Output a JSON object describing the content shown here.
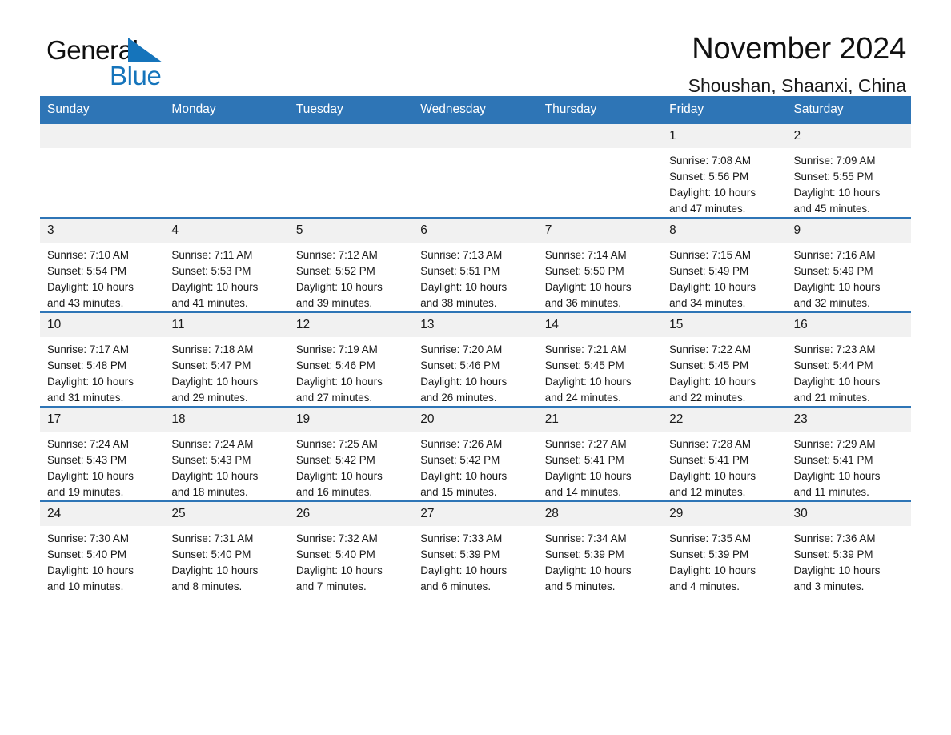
{
  "brand": {
    "word_one": "General",
    "word_two": "Blue",
    "accent_color": "#1574bb"
  },
  "header": {
    "title": "November 2024",
    "subtitle": "Shoushan, Shaanxi, China"
  },
  "theme": {
    "header_blue": "#2e75b6",
    "daynum_gray": "#f1f1f1",
    "text": "#1a1a1a"
  },
  "weekdays": [
    "Sunday",
    "Monday",
    "Tuesday",
    "Wednesday",
    "Thursday",
    "Friday",
    "Saturday"
  ],
  "labels": {
    "sunrise_prefix": "Sunrise:",
    "sunset_prefix": "Sunset:",
    "daylight_prefix": "Daylight:"
  },
  "weeks": [
    [
      {
        "day": "",
        "blank": true
      },
      {
        "day": "",
        "blank": true
      },
      {
        "day": "",
        "blank": true
      },
      {
        "day": "",
        "blank": true
      },
      {
        "day": "",
        "blank": true
      },
      {
        "day": "1",
        "sunrise": "Sunrise: 7:08 AM",
        "sunset": "Sunset: 5:56 PM",
        "daylight_1": "Daylight: 10 hours",
        "daylight_2": "and 47 minutes."
      },
      {
        "day": "2",
        "sunrise": "Sunrise: 7:09 AM",
        "sunset": "Sunset: 5:55 PM",
        "daylight_1": "Daylight: 10 hours",
        "daylight_2": "and 45 minutes."
      }
    ],
    [
      {
        "day": "3",
        "sunrise": "Sunrise: 7:10 AM",
        "sunset": "Sunset: 5:54 PM",
        "daylight_1": "Daylight: 10 hours",
        "daylight_2": "and 43 minutes."
      },
      {
        "day": "4",
        "sunrise": "Sunrise: 7:11 AM",
        "sunset": "Sunset: 5:53 PM",
        "daylight_1": "Daylight: 10 hours",
        "daylight_2": "and 41 minutes."
      },
      {
        "day": "5",
        "sunrise": "Sunrise: 7:12 AM",
        "sunset": "Sunset: 5:52 PM",
        "daylight_1": "Daylight: 10 hours",
        "daylight_2": "and 39 minutes."
      },
      {
        "day": "6",
        "sunrise": "Sunrise: 7:13 AM",
        "sunset": "Sunset: 5:51 PM",
        "daylight_1": "Daylight: 10 hours",
        "daylight_2": "and 38 minutes."
      },
      {
        "day": "7",
        "sunrise": "Sunrise: 7:14 AM",
        "sunset": "Sunset: 5:50 PM",
        "daylight_1": "Daylight: 10 hours",
        "daylight_2": "and 36 minutes."
      },
      {
        "day": "8",
        "sunrise": "Sunrise: 7:15 AM",
        "sunset": "Sunset: 5:49 PM",
        "daylight_1": "Daylight: 10 hours",
        "daylight_2": "and 34 minutes."
      },
      {
        "day": "9",
        "sunrise": "Sunrise: 7:16 AM",
        "sunset": "Sunset: 5:49 PM",
        "daylight_1": "Daylight: 10 hours",
        "daylight_2": "and 32 minutes."
      }
    ],
    [
      {
        "day": "10",
        "sunrise": "Sunrise: 7:17 AM",
        "sunset": "Sunset: 5:48 PM",
        "daylight_1": "Daylight: 10 hours",
        "daylight_2": "and 31 minutes."
      },
      {
        "day": "11",
        "sunrise": "Sunrise: 7:18 AM",
        "sunset": "Sunset: 5:47 PM",
        "daylight_1": "Daylight: 10 hours",
        "daylight_2": "and 29 minutes."
      },
      {
        "day": "12",
        "sunrise": "Sunrise: 7:19 AM",
        "sunset": "Sunset: 5:46 PM",
        "daylight_1": "Daylight: 10 hours",
        "daylight_2": "and 27 minutes."
      },
      {
        "day": "13",
        "sunrise": "Sunrise: 7:20 AM",
        "sunset": "Sunset: 5:46 PM",
        "daylight_1": "Daylight: 10 hours",
        "daylight_2": "and 26 minutes."
      },
      {
        "day": "14",
        "sunrise": "Sunrise: 7:21 AM",
        "sunset": "Sunset: 5:45 PM",
        "daylight_1": "Daylight: 10 hours",
        "daylight_2": "and 24 minutes."
      },
      {
        "day": "15",
        "sunrise": "Sunrise: 7:22 AM",
        "sunset": "Sunset: 5:45 PM",
        "daylight_1": "Daylight: 10 hours",
        "daylight_2": "and 22 minutes."
      },
      {
        "day": "16",
        "sunrise": "Sunrise: 7:23 AM",
        "sunset": "Sunset: 5:44 PM",
        "daylight_1": "Daylight: 10 hours",
        "daylight_2": "and 21 minutes."
      }
    ],
    [
      {
        "day": "17",
        "sunrise": "Sunrise: 7:24 AM",
        "sunset": "Sunset: 5:43 PM",
        "daylight_1": "Daylight: 10 hours",
        "daylight_2": "and 19 minutes."
      },
      {
        "day": "18",
        "sunrise": "Sunrise: 7:24 AM",
        "sunset": "Sunset: 5:43 PM",
        "daylight_1": "Daylight: 10 hours",
        "daylight_2": "and 18 minutes."
      },
      {
        "day": "19",
        "sunrise": "Sunrise: 7:25 AM",
        "sunset": "Sunset: 5:42 PM",
        "daylight_1": "Daylight: 10 hours",
        "daylight_2": "and 16 minutes."
      },
      {
        "day": "20",
        "sunrise": "Sunrise: 7:26 AM",
        "sunset": "Sunset: 5:42 PM",
        "daylight_1": "Daylight: 10 hours",
        "daylight_2": "and 15 minutes."
      },
      {
        "day": "21",
        "sunrise": "Sunrise: 7:27 AM",
        "sunset": "Sunset: 5:41 PM",
        "daylight_1": "Daylight: 10 hours",
        "daylight_2": "and 14 minutes."
      },
      {
        "day": "22",
        "sunrise": "Sunrise: 7:28 AM",
        "sunset": "Sunset: 5:41 PM",
        "daylight_1": "Daylight: 10 hours",
        "daylight_2": "and 12 minutes."
      },
      {
        "day": "23",
        "sunrise": "Sunrise: 7:29 AM",
        "sunset": "Sunset: 5:41 PM",
        "daylight_1": "Daylight: 10 hours",
        "daylight_2": "and 11 minutes."
      }
    ],
    [
      {
        "day": "24",
        "sunrise": "Sunrise: 7:30 AM",
        "sunset": "Sunset: 5:40 PM",
        "daylight_1": "Daylight: 10 hours",
        "daylight_2": "and 10 minutes."
      },
      {
        "day": "25",
        "sunrise": "Sunrise: 7:31 AM",
        "sunset": "Sunset: 5:40 PM",
        "daylight_1": "Daylight: 10 hours",
        "daylight_2": "and 8 minutes."
      },
      {
        "day": "26",
        "sunrise": "Sunrise: 7:32 AM",
        "sunset": "Sunset: 5:40 PM",
        "daylight_1": "Daylight: 10 hours",
        "daylight_2": "and 7 minutes."
      },
      {
        "day": "27",
        "sunrise": "Sunrise: 7:33 AM",
        "sunset": "Sunset: 5:39 PM",
        "daylight_1": "Daylight: 10 hours",
        "daylight_2": "and 6 minutes."
      },
      {
        "day": "28",
        "sunrise": "Sunrise: 7:34 AM",
        "sunset": "Sunset: 5:39 PM",
        "daylight_1": "Daylight: 10 hours",
        "daylight_2": "and 5 minutes."
      },
      {
        "day": "29",
        "sunrise": "Sunrise: 7:35 AM",
        "sunset": "Sunset: 5:39 PM",
        "daylight_1": "Daylight: 10 hours",
        "daylight_2": "and 4 minutes."
      },
      {
        "day": "30",
        "sunrise": "Sunrise: 7:36 AM",
        "sunset": "Sunset: 5:39 PM",
        "daylight_1": "Daylight: 10 hours",
        "daylight_2": "and 3 minutes."
      }
    ]
  ]
}
